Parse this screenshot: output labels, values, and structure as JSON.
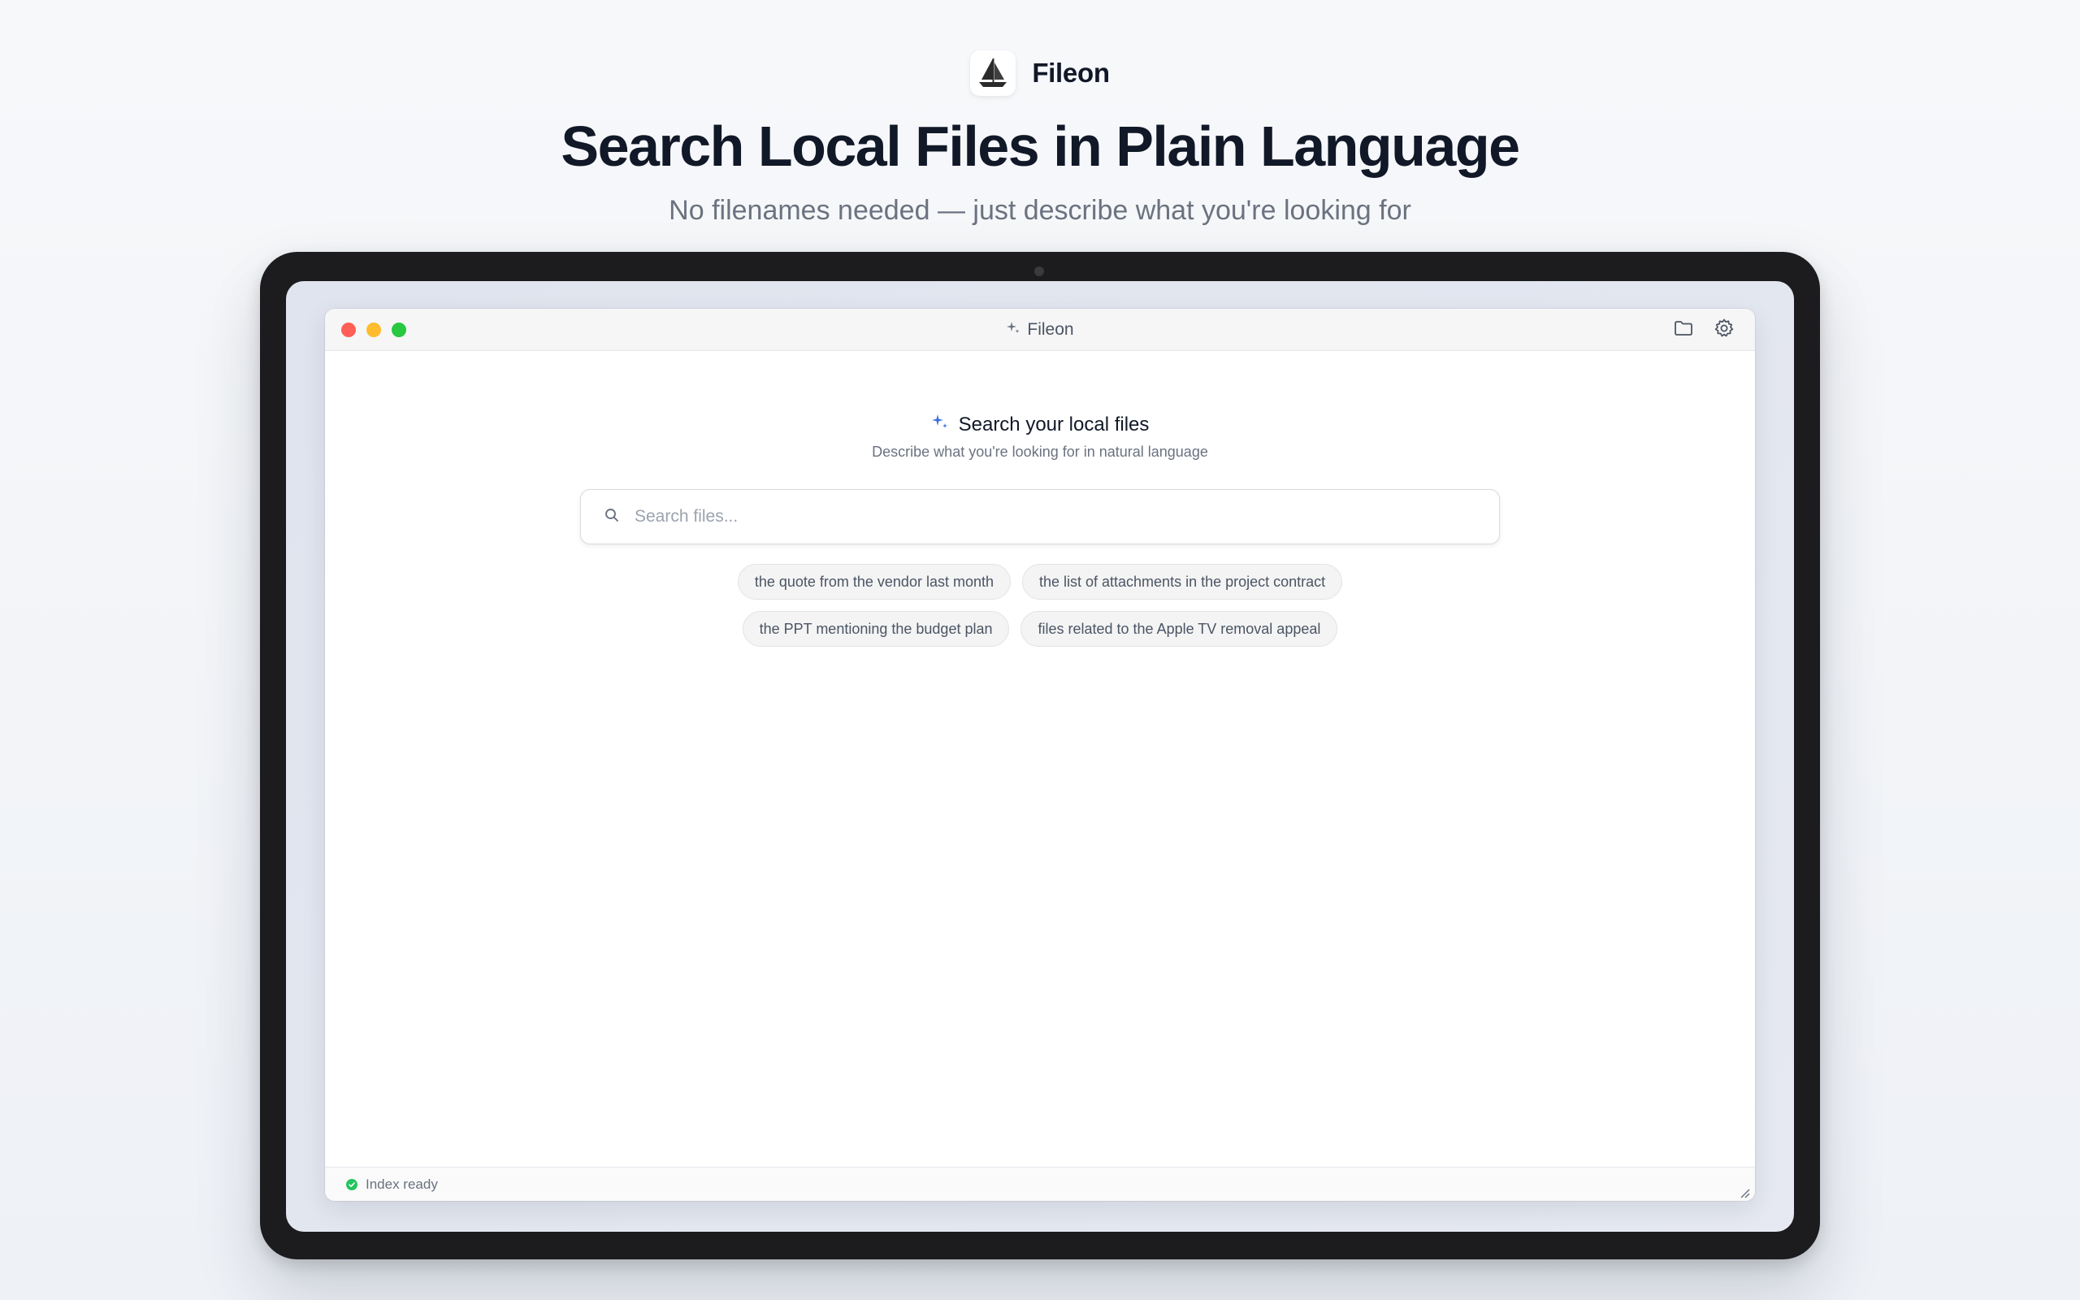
{
  "brand": {
    "name": "Fileon",
    "logo_icon": "sailboat-icon"
  },
  "hero": {
    "title": "Search Local Files in Plain Language",
    "subtitle": "No filenames needed — just describe what you're looking for"
  },
  "window": {
    "title": "Fileon",
    "title_icon": "sparkle-icon",
    "actions": [
      {
        "name": "folder",
        "icon": "folder-icon"
      },
      {
        "name": "settings",
        "icon": "gear-icon"
      }
    ],
    "traffic_lights": {
      "close": "#ff5f57",
      "minimize": "#febc2e",
      "maximize": "#28c840"
    }
  },
  "search": {
    "heading": "Search your local files",
    "description": "Describe what you're looking for in natural language",
    "placeholder": "Search files...",
    "value": ""
  },
  "suggestions": [
    "the quote from the vendor last month",
    "the list of attachments in the project contract",
    "the PPT mentioning the budget plan",
    "files related to the Apple TV removal appeal"
  ],
  "status": {
    "text": "Index ready",
    "color": "#22c55e"
  },
  "colors": {
    "accent": "#3b6fe0",
    "text_primary": "#111827",
    "text_muted": "#6b7280"
  }
}
